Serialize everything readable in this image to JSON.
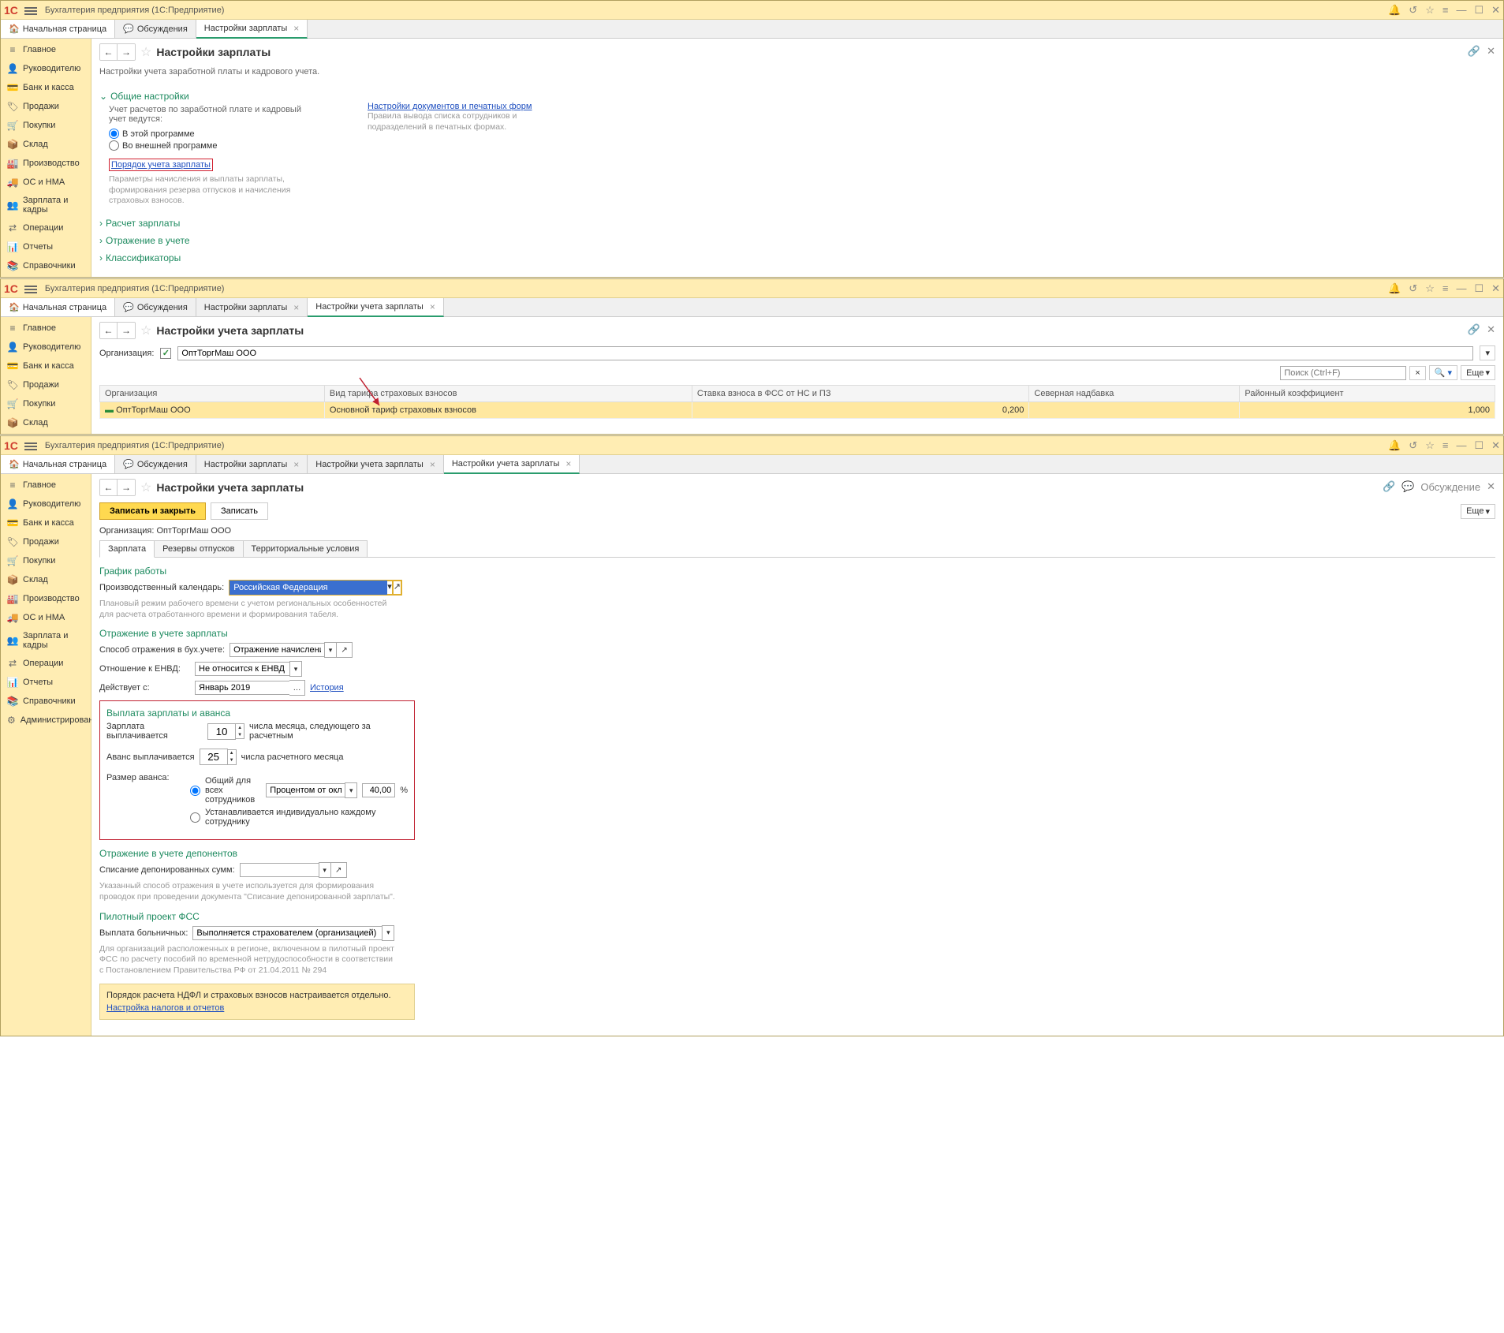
{
  "app_title": "Бухгалтерия предприятия  (1С:Предприятие)",
  "tabs": {
    "home": "Начальная страница",
    "discussions": "Обсуждения",
    "salary_settings": "Настройки зарплаты",
    "salary_acc_settings": "Настройки учета зарплаты"
  },
  "sidebar": {
    "main": "Главное",
    "manager": "Руководителю",
    "bank": "Банк и касса",
    "sales": "Продажи",
    "purchases": "Покупки",
    "warehouse": "Склад",
    "production": "Производство",
    "os_nma": "ОС и НМА",
    "salary_hr": "Зарплата и кадры",
    "operations": "Операции",
    "reports": "Отчеты",
    "references": "Справочники",
    "admin": "Администрирование"
  },
  "win1": {
    "title": "Настройки зарплаты",
    "subtitle": "Настройки учета заработной платы и кадрового учета.",
    "general": {
      "header": "Общие настройки",
      "desc": "Учет расчетов по заработной плате и кадровый учет ведутся:",
      "radio1": "В этой программе",
      "radio2": "Во внешней программе",
      "link": "Порядок учета зарплаты",
      "link_desc": "Параметры начисления и выплаты зарплаты, формирования резерва отпусков и начисления страховых взносов."
    },
    "right": {
      "link": "Настройки документов и печатных форм",
      "desc": "Правила вывода списка сотрудников и подразделений в печатных формах."
    },
    "sections": {
      "calc": "Расчет зарплаты",
      "reflection": "Отражение в учете",
      "classifiers": "Классификаторы"
    }
  },
  "win2": {
    "title": "Настройки учета зарплаты",
    "org_label": "Организация:",
    "org_value": "ОптТоргМаш ООО",
    "search_placeholder": "Поиск (Ctrl+F)",
    "more_btn": "Еще",
    "table": {
      "col1": "Организация",
      "col2": "Вид тарифа страховых взносов",
      "col3": "Ставка взноса в ФСС от НС и ПЗ",
      "col4": "Северная надбавка",
      "col5": "Районный коэффициент",
      "row": {
        "org": "ОптТоргМаш ООО",
        "tariff": "Основной тариф страховых взносов",
        "fss": "0,200",
        "north": "",
        "region": "1,000"
      }
    }
  },
  "win3": {
    "title": "Настройки учета зарплаты",
    "save_close": "Записать и закрыть",
    "save": "Записать",
    "discussion": "Обсуждение",
    "more": "Еще",
    "org_line_label": "Организация:",
    "org_line_value": "ОптТоргМаш ООО",
    "inner_tabs": {
      "salary": "Зарплата",
      "reserves": "Резервы отпусков",
      "territory": "Территориальные условия"
    },
    "schedule": {
      "header": "График работы",
      "label": "Производственный календарь:",
      "value": "Российская Федерация",
      "desc": "Плановый режим рабочего времени с учетом региональных особенностей для расчета отработанного времени и формирования табеля."
    },
    "reflection": {
      "header": "Отражение в учете зарплаты",
      "way_label": "Способ отражения в бух.учете:",
      "way_value": "Отражение начислений по",
      "envd_label": "Отношение к ЕНВД:",
      "envd_value": "Не относится к ЕНВД",
      "since_label": "Действует с:",
      "since_value": "Январь 2019",
      "history": "История"
    },
    "payment": {
      "header": "Выплата зарплаты и аванса",
      "salary_label": "Зарплата выплачивается",
      "salary_day": "10",
      "salary_suffix": "числа месяца, следующего за расчетным",
      "advance_label": "Аванс выплачивается",
      "advance_day": "25",
      "advance_suffix": "числа расчетного месяца",
      "size_label": "Размер аванса:",
      "radio_common": "Общий для всех сотрудников",
      "percent_mode": "Процентом от оклада",
      "percent_value": "40,00",
      "percent_sign": "%",
      "radio_individual": "Устанавливается индивидуально каждому сотруднику"
    },
    "deponents": {
      "header": "Отражение в учете депонентов",
      "label": "Списание депонированных сумм:",
      "desc": "Указанный способ отражения в учете используется для формирования проводок при проведении документа \"Списание депонированной зарплаты\"."
    },
    "fss": {
      "header": "Пилотный проект ФСС",
      "label": "Выплата больничных:",
      "value": "Выполняется страхователем (организацией)",
      "desc": "Для организаций расположенных в регионе, включенном в пилотный проект ФСС по расчету пособий по временной нетрудоспособности в соответствии с Постановлением Правительства РФ от 21.04.2011 № 294"
    },
    "note": {
      "text": "Порядок расчета НДФЛ и страховых взносов настраивается отдельно.",
      "link": "Настройка налогов и отчетов"
    }
  }
}
